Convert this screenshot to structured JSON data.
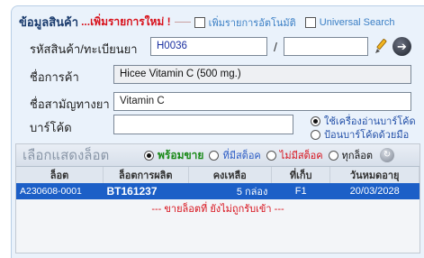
{
  "header": {
    "title": "ข้อมูลสินค้า",
    "new_item": "...เพิ่มรายการใหม่ !",
    "auto_add_label": "เพิ่มรายการอัตโนมัติ",
    "universal_search_label": "Universal Search"
  },
  "form": {
    "code_label": "รหัสสินค้า/ทะเบียนยา",
    "code_value": "H0036",
    "reg_value": "",
    "slash": "/",
    "trade_name_label": "ชื่อการค้า",
    "trade_name_value": "Hicee Vitamin C (500 mg.)",
    "generic_name_label": "ชื่อสามัญทางยา",
    "generic_name_value": "Vitamin C",
    "barcode_label": "บาร์โค้ด",
    "barcode_value": "",
    "scan_option_1": "ใช้เครื่องอ่านบาร์โค้ด",
    "scan_option_2": "ป้อนบาร์โค้ดด้วยมือ",
    "go_symbol": "➔"
  },
  "lots": {
    "title": "เลือกแสดงล็อต",
    "filter_ready": "พร้อมขาย",
    "filter_in_stock": "ที่มีสต็อค",
    "filter_no_stock": "ไม่มีสต็อค",
    "filter_all": "ทุกล็อต",
    "columns": [
      "ล็อต",
      "ล็อตการผลิต",
      "คงเหลือ",
      "ที่เก็บ",
      "วันหมดอายุ"
    ],
    "rows": [
      {
        "lot": "A230608-0001",
        "batch": "BT161237",
        "remaining": "5 กล่อง",
        "location": "F1",
        "expiry": "20/03/2028"
      }
    ],
    "note": "--- ขายล็อตที่ ยังไม่ถูกรับเข้า ---"
  },
  "colors": {
    "accent_red": "#d8111b",
    "accent_green": "#1a8a19",
    "selected_row": "#1c5fc7",
    "panel_bg": "#eaf2fb"
  },
  "icons": {
    "pencil": "pencil-icon",
    "go": "arrow-circle-icon",
    "refresh": "refresh-icon"
  }
}
